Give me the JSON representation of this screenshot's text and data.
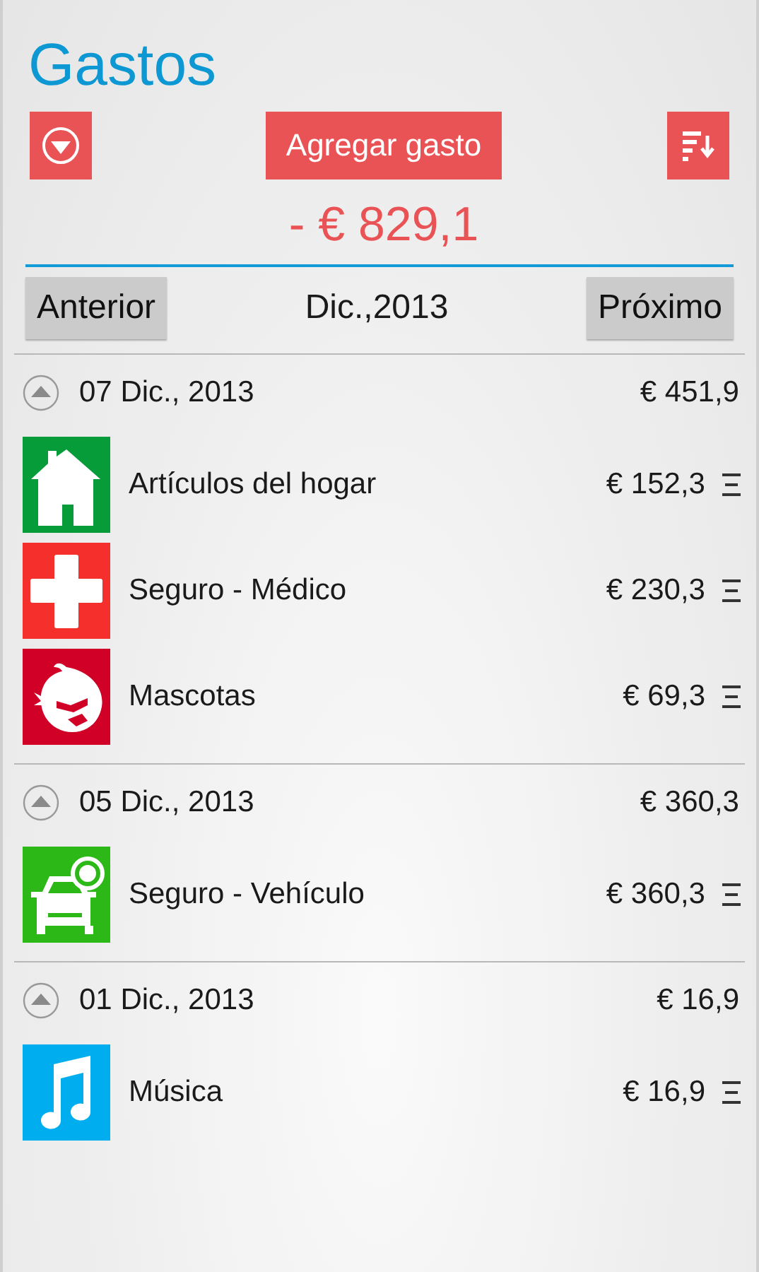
{
  "title": "Gastos",
  "add_button": {
    "label": "Agregar gasto"
  },
  "total": "- € 829,1",
  "period": {
    "previous": "Anterior",
    "label": "Dic.,2013",
    "next": "Próximo"
  },
  "groups": [
    {
      "date": "07 Dic., 2013",
      "total": "€ 451,9",
      "expanded": true,
      "items": [
        {
          "name": "Artículos del hogar",
          "amount": "€ 152,3",
          "kind": "house",
          "color": "#069c3a"
        },
        {
          "name": "Seguro - Médico",
          "amount": "€ 230,3",
          "kind": "medical",
          "color": "#f5302c"
        },
        {
          "name": "Mascotas",
          "amount": "€ 69,3",
          "kind": "pet",
          "color": "#d00027"
        }
      ]
    },
    {
      "date": "05 Dic., 2013",
      "total": "€ 360,3",
      "expanded": true,
      "items": [
        {
          "name": "Seguro - Vehículo",
          "amount": "€ 360,3",
          "kind": "car",
          "color": "#2cb816"
        }
      ]
    },
    {
      "date": "01 Dic., 2013",
      "total": "€ 16,9",
      "expanded": true,
      "items": [
        {
          "name": "Música",
          "amount": "€ 16,9",
          "kind": "music",
          "color": "#00aeef"
        }
      ]
    }
  ]
}
